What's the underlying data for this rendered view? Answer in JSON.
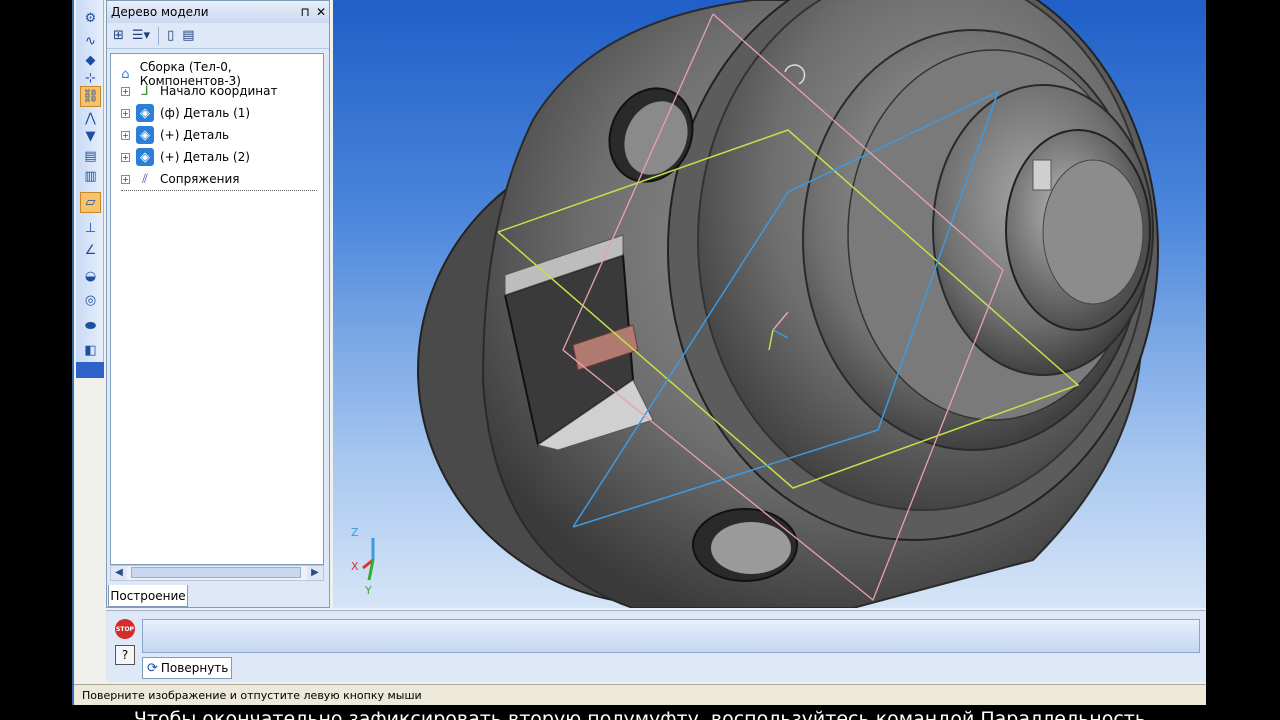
{
  "tree_panel": {
    "title": "Дерево модели",
    "pin_icon": "pin-icon",
    "close_icon": "close-icon",
    "root": "Сборка (Тел-0, Компонентов-3)",
    "items": [
      {
        "label": "Начало координат",
        "icon": "origin-axes-icon"
      },
      {
        "label": "(ф) Деталь (1)",
        "icon": "part-icon"
      },
      {
        "label": "(+) Деталь",
        "icon": "part-icon"
      },
      {
        "label": "(+) Деталь (2)",
        "icon": "part-icon"
      },
      {
        "label": "Сопряжения",
        "icon": "mates-icon"
      }
    ],
    "tab": "Построение"
  },
  "property_bar": {
    "stop_label": "STOP",
    "help_label": "?",
    "rotate_tab": "Повернуть"
  },
  "status_bar": {
    "text": "Поверните изображение и отпустите левую кнопку мыши"
  },
  "axes": {
    "z": "Z",
    "x": "X",
    "y": "Y"
  },
  "subtitle": "Чтобы окончательно зафиксировать вторую полумуфту, воспользуйтесь командой Параллельность",
  "colors": {
    "viewport_top": "#1f5fc7",
    "viewport_bottom": "#d6e5f7",
    "model_gray": "#6b6b6b",
    "plane_yellow": "#c4e04a",
    "plane_blue": "#3d9ae0",
    "plane_pink": "#e8a0b0"
  }
}
